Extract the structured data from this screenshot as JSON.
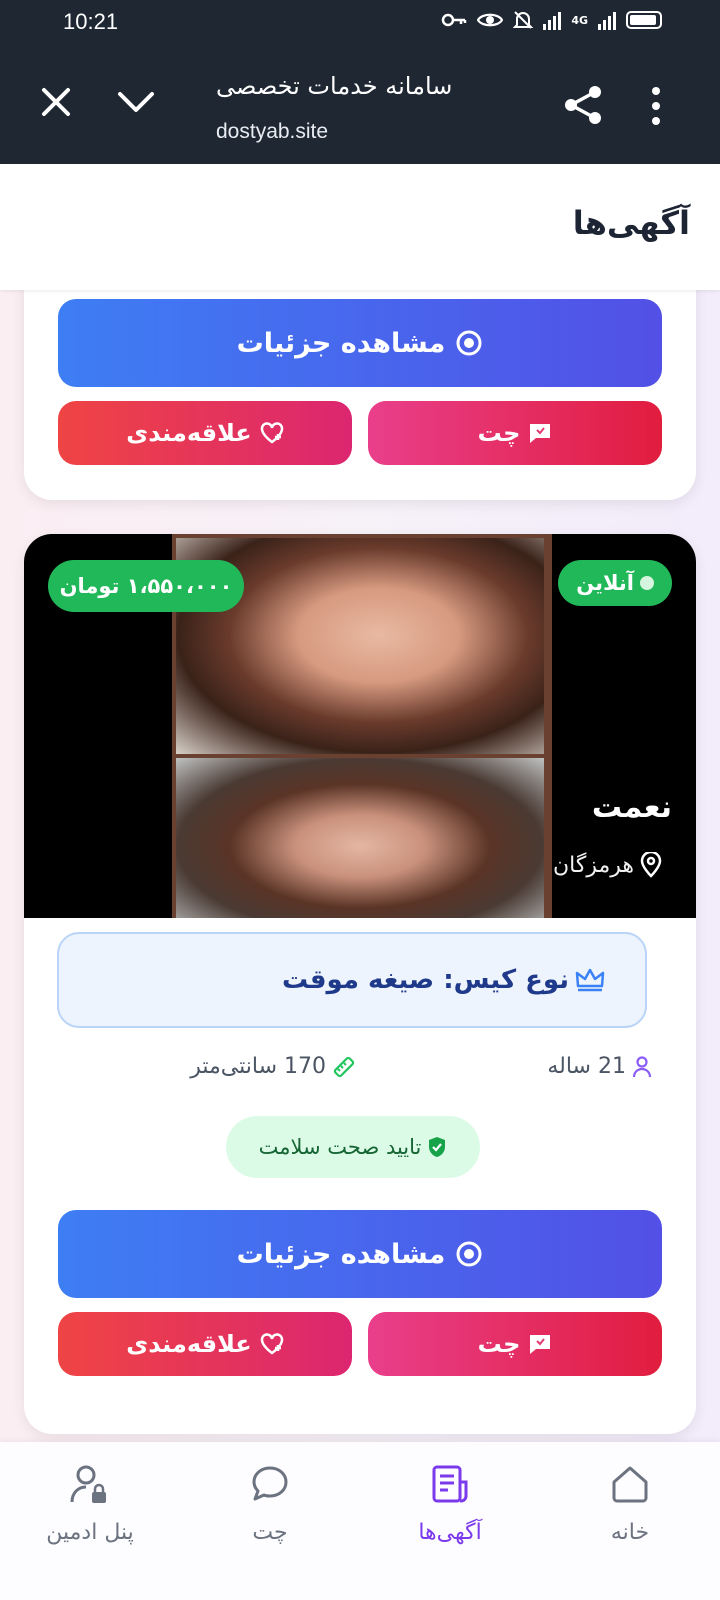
{
  "status_bar": {
    "time": "10:21",
    "network": "4G"
  },
  "browser": {
    "title": "سامانه خدمات تخصصی",
    "url": "dostyab.site"
  },
  "page": {
    "title": "آگهی‌ها"
  },
  "card1": {
    "details_label": "مشاهده جزئیات",
    "chat_label": "چت",
    "favorite_label": "علاقه‌مندی"
  },
  "card2": {
    "status": "آنلاین",
    "price": "۱،۵۵۰،۰۰۰ تومان",
    "name": "نعمت",
    "city": "هرمزگان",
    "case_type": "نوع کیس: صیغه موقت",
    "age": "21 ساله",
    "height": "170 سانتی‌متر",
    "health": "تایید صحت سلامت",
    "details_label": "مشاهده جزئیات",
    "chat_label": "چت",
    "favorite_label": "علاقه‌مندی"
  },
  "bottom_nav": {
    "items": [
      {
        "label": "پنل ادمین",
        "icon": "user-lock-icon"
      },
      {
        "label": "چت",
        "icon": "chat-bubble-icon"
      },
      {
        "label": "آگهی‌ها",
        "icon": "document-list-icon",
        "active": true
      },
      {
        "label": "خانه",
        "icon": "home-icon"
      }
    ]
  },
  "colors": {
    "accent": "#7c3aed",
    "online_badge": "#21b85a",
    "details_gradient": [
      "#3e7ef4",
      "#5250e6"
    ],
    "chat_gradient": [
      "#e93f8b",
      "#e11d3f"
    ],
    "favorite_gradient": [
      "#ef4444",
      "#dc2670"
    ]
  }
}
